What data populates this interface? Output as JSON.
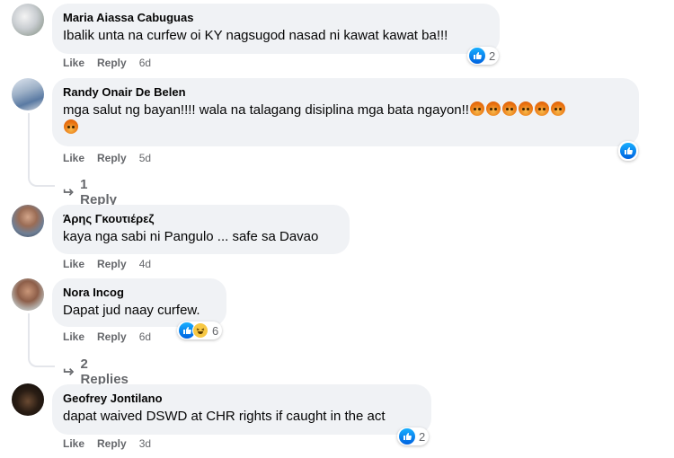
{
  "comments": [
    {
      "author": "Maria Aiassa Cabuguas",
      "text": "Ibalik unta na curfew oi KY nagsugod nasad ni kawat kawat ba!!!",
      "actions": {
        "like": "Like",
        "reply": "Reply",
        "time": "6d"
      },
      "reaction_count": "2",
      "reactions": [
        "like-icon"
      ]
    },
    {
      "author": "Randy Onair De Belen",
      "text": "mga salut ng bayan!!!! wala na talagang disiplina mga bata ngayon!!",
      "emojis": [
        "angry-face-icon",
        "angry-face-icon",
        "angry-face-icon",
        "angry-face-icon",
        "angry-face-icon",
        "angry-face-icon",
        "angry-face-icon"
      ],
      "actions": {
        "like": "Like",
        "reply": "Reply",
        "time": "5d"
      },
      "reactions": [
        "like-icon"
      ],
      "replies_label": "1 Reply"
    },
    {
      "author": "Άρης Γκουτιέρεζ",
      "text": "kaya nga sabi ni Pangulo ... safe sa Davao",
      "actions": {
        "like": "Like",
        "reply": "Reply",
        "time": "4d"
      }
    },
    {
      "author": "Nora Incog",
      "text": "Dapat jud naay curfew.",
      "actions": {
        "like": "Like",
        "reply": "Reply",
        "time": "6d"
      },
      "reaction_count": "6",
      "reactions": [
        "like-icon",
        "haha-icon"
      ],
      "replies_label": "2 Replies"
    },
    {
      "author": "Geofrey Jontilano",
      "text": "dapat waived DSWD at CHR rights if caught in the act",
      "actions": {
        "like": "Like",
        "reply": "Reply",
        "time": "3d"
      },
      "reaction_count": "2",
      "reactions": [
        "like-icon"
      ]
    }
  ],
  "colors": {
    "bubble": "#f0f2f5",
    "meta": "#65676b",
    "like_blue": "#1877f2",
    "haha_yellow": "#f7c844",
    "angry_orange": "#e9710f"
  }
}
